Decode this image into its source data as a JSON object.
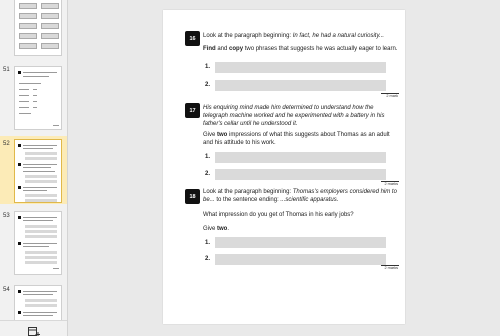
{
  "sidebar": {
    "pages": [
      {
        "number": "",
        "selected": false
      },
      {
        "number": "51",
        "selected": false
      },
      {
        "number": "52",
        "selected": true
      },
      {
        "number": "53",
        "selected": false
      },
      {
        "number": "54",
        "selected": false
      }
    ],
    "add_page_icon": "add-page-icon"
  },
  "page": {
    "questions": [
      {
        "number": "16",
        "prompt_plain": "Look at the paragraph beginning: ",
        "prompt_italic": "In fact, he had a natural curiosity...",
        "instruction_bold1": "Find",
        "instruction_mid1": " and ",
        "instruction_bold2": "copy",
        "instruction_rest": " two phrases that suggests he was actually eager to learn.",
        "answers": [
          "1.",
          "2."
        ],
        "marks": "2 mark"
      },
      {
        "number": "17",
        "prompt_italic": "His enquiring mind made him determined to understand how the telegraph machine worked and he experimented with a battery in his father's cellar until he understood it.",
        "instruction_pre": "Give ",
        "instruction_bold": "two",
        "instruction_rest": " impressions of what this suggests about Thomas as an adult and his attitude to his work.",
        "answers": [
          "1.",
          "2."
        ],
        "marks": "2 marks"
      },
      {
        "number": "18",
        "prompt_plain": "Look at the paragraph beginning: ",
        "prompt_italic": "Thomas's employers considered him to be...",
        "prompt_tail_plain": " to the sentence ending: ",
        "prompt_tail_italic": "...scientific apparatus.",
        "question_text": "What impression do you get of Thomas in his early jobs?",
        "give_pre": "Give ",
        "give_bold": "two",
        "give_post": ".",
        "answers": [
          "1.",
          "2."
        ],
        "marks": "2 marks"
      }
    ]
  }
}
